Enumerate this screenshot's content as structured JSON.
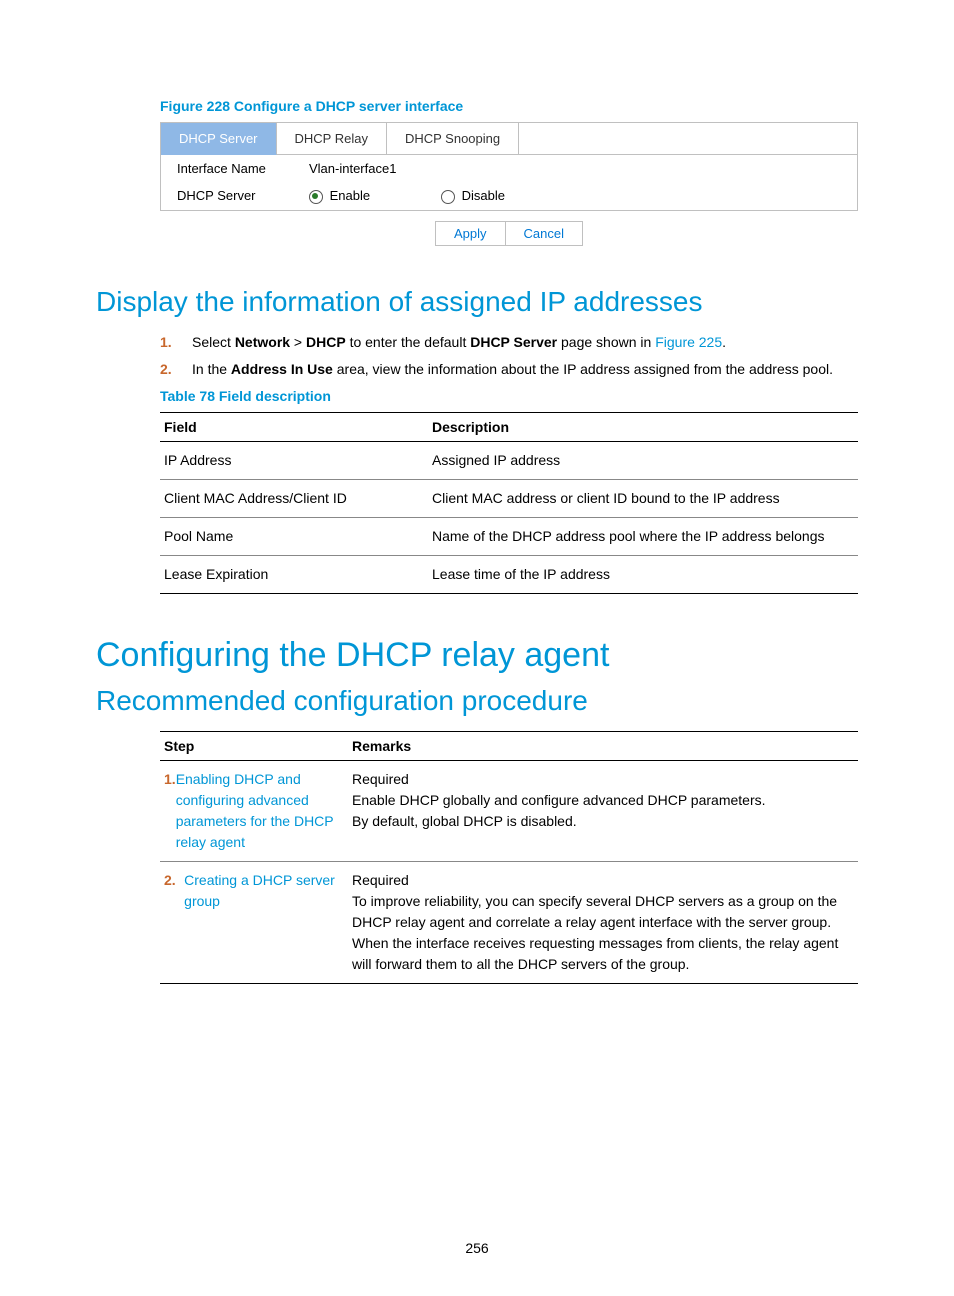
{
  "figure": {
    "caption": "Figure 228 Configure a DHCP server interface",
    "tabs": {
      "server": "DHCP Server",
      "relay": "DHCP Relay",
      "snooping": "DHCP Snooping"
    },
    "row1": {
      "label": "Interface Name",
      "value": "Vlan-interface1"
    },
    "row2": {
      "label": "DHCP Server",
      "opt1": "Enable",
      "opt2": "Disable"
    },
    "buttons": {
      "apply": "Apply",
      "cancel": "Cancel"
    }
  },
  "h2a": "Display the information of assigned IP addresses",
  "steps1": {
    "n1": "1.",
    "s1a": "Select ",
    "s1b": "Network",
    "s1c": " > ",
    "s1d": "DHCP",
    "s1e": " to enter the default ",
    "s1f": "DHCP Server",
    "s1g": " page shown in ",
    "s1h": "Figure 225",
    "s1i": ".",
    "n2": "2.",
    "s2a": "In the ",
    "s2b": "Address In Use",
    "s2c": " area, view the information about the IP address assigned from the address pool."
  },
  "table78": {
    "caption": "Table 78 Field description",
    "h1": "Field",
    "h2": "Description",
    "r1f": "IP Address",
    "r1d": "Assigned IP address",
    "r2f": "Client MAC Address/Client ID",
    "r2d": "Client MAC address or client ID bound to the IP address",
    "r3f": "Pool Name",
    "r3d": "Name of the DHCP address pool where the IP address belongs",
    "r4f": "Lease Expiration",
    "r4d": "Lease time of the IP address"
  },
  "h1": "Configuring the DHCP relay agent",
  "h2b": "Recommended configuration procedure",
  "proc": {
    "h1": "Step",
    "h2": "Remarks",
    "n1": "1.",
    "link1": "Enabling DHCP and configuring advanced parameters for the DHCP relay agent",
    "r1a": "Required",
    "r1b": "Enable DHCP globally and configure advanced DHCP parameters.",
    "r1c": "By default, global DHCP is disabled.",
    "n2": "2.",
    "link2": "Creating a DHCP server group",
    "r2a": "Required",
    "r2b": "To improve reliability, you can specify several DHCP servers as a group on the DHCP relay agent and correlate a relay agent interface with the server group. When the interface receives requesting messages from clients, the relay agent will forward them to all the DHCP servers of the group."
  },
  "pagenum": "256"
}
